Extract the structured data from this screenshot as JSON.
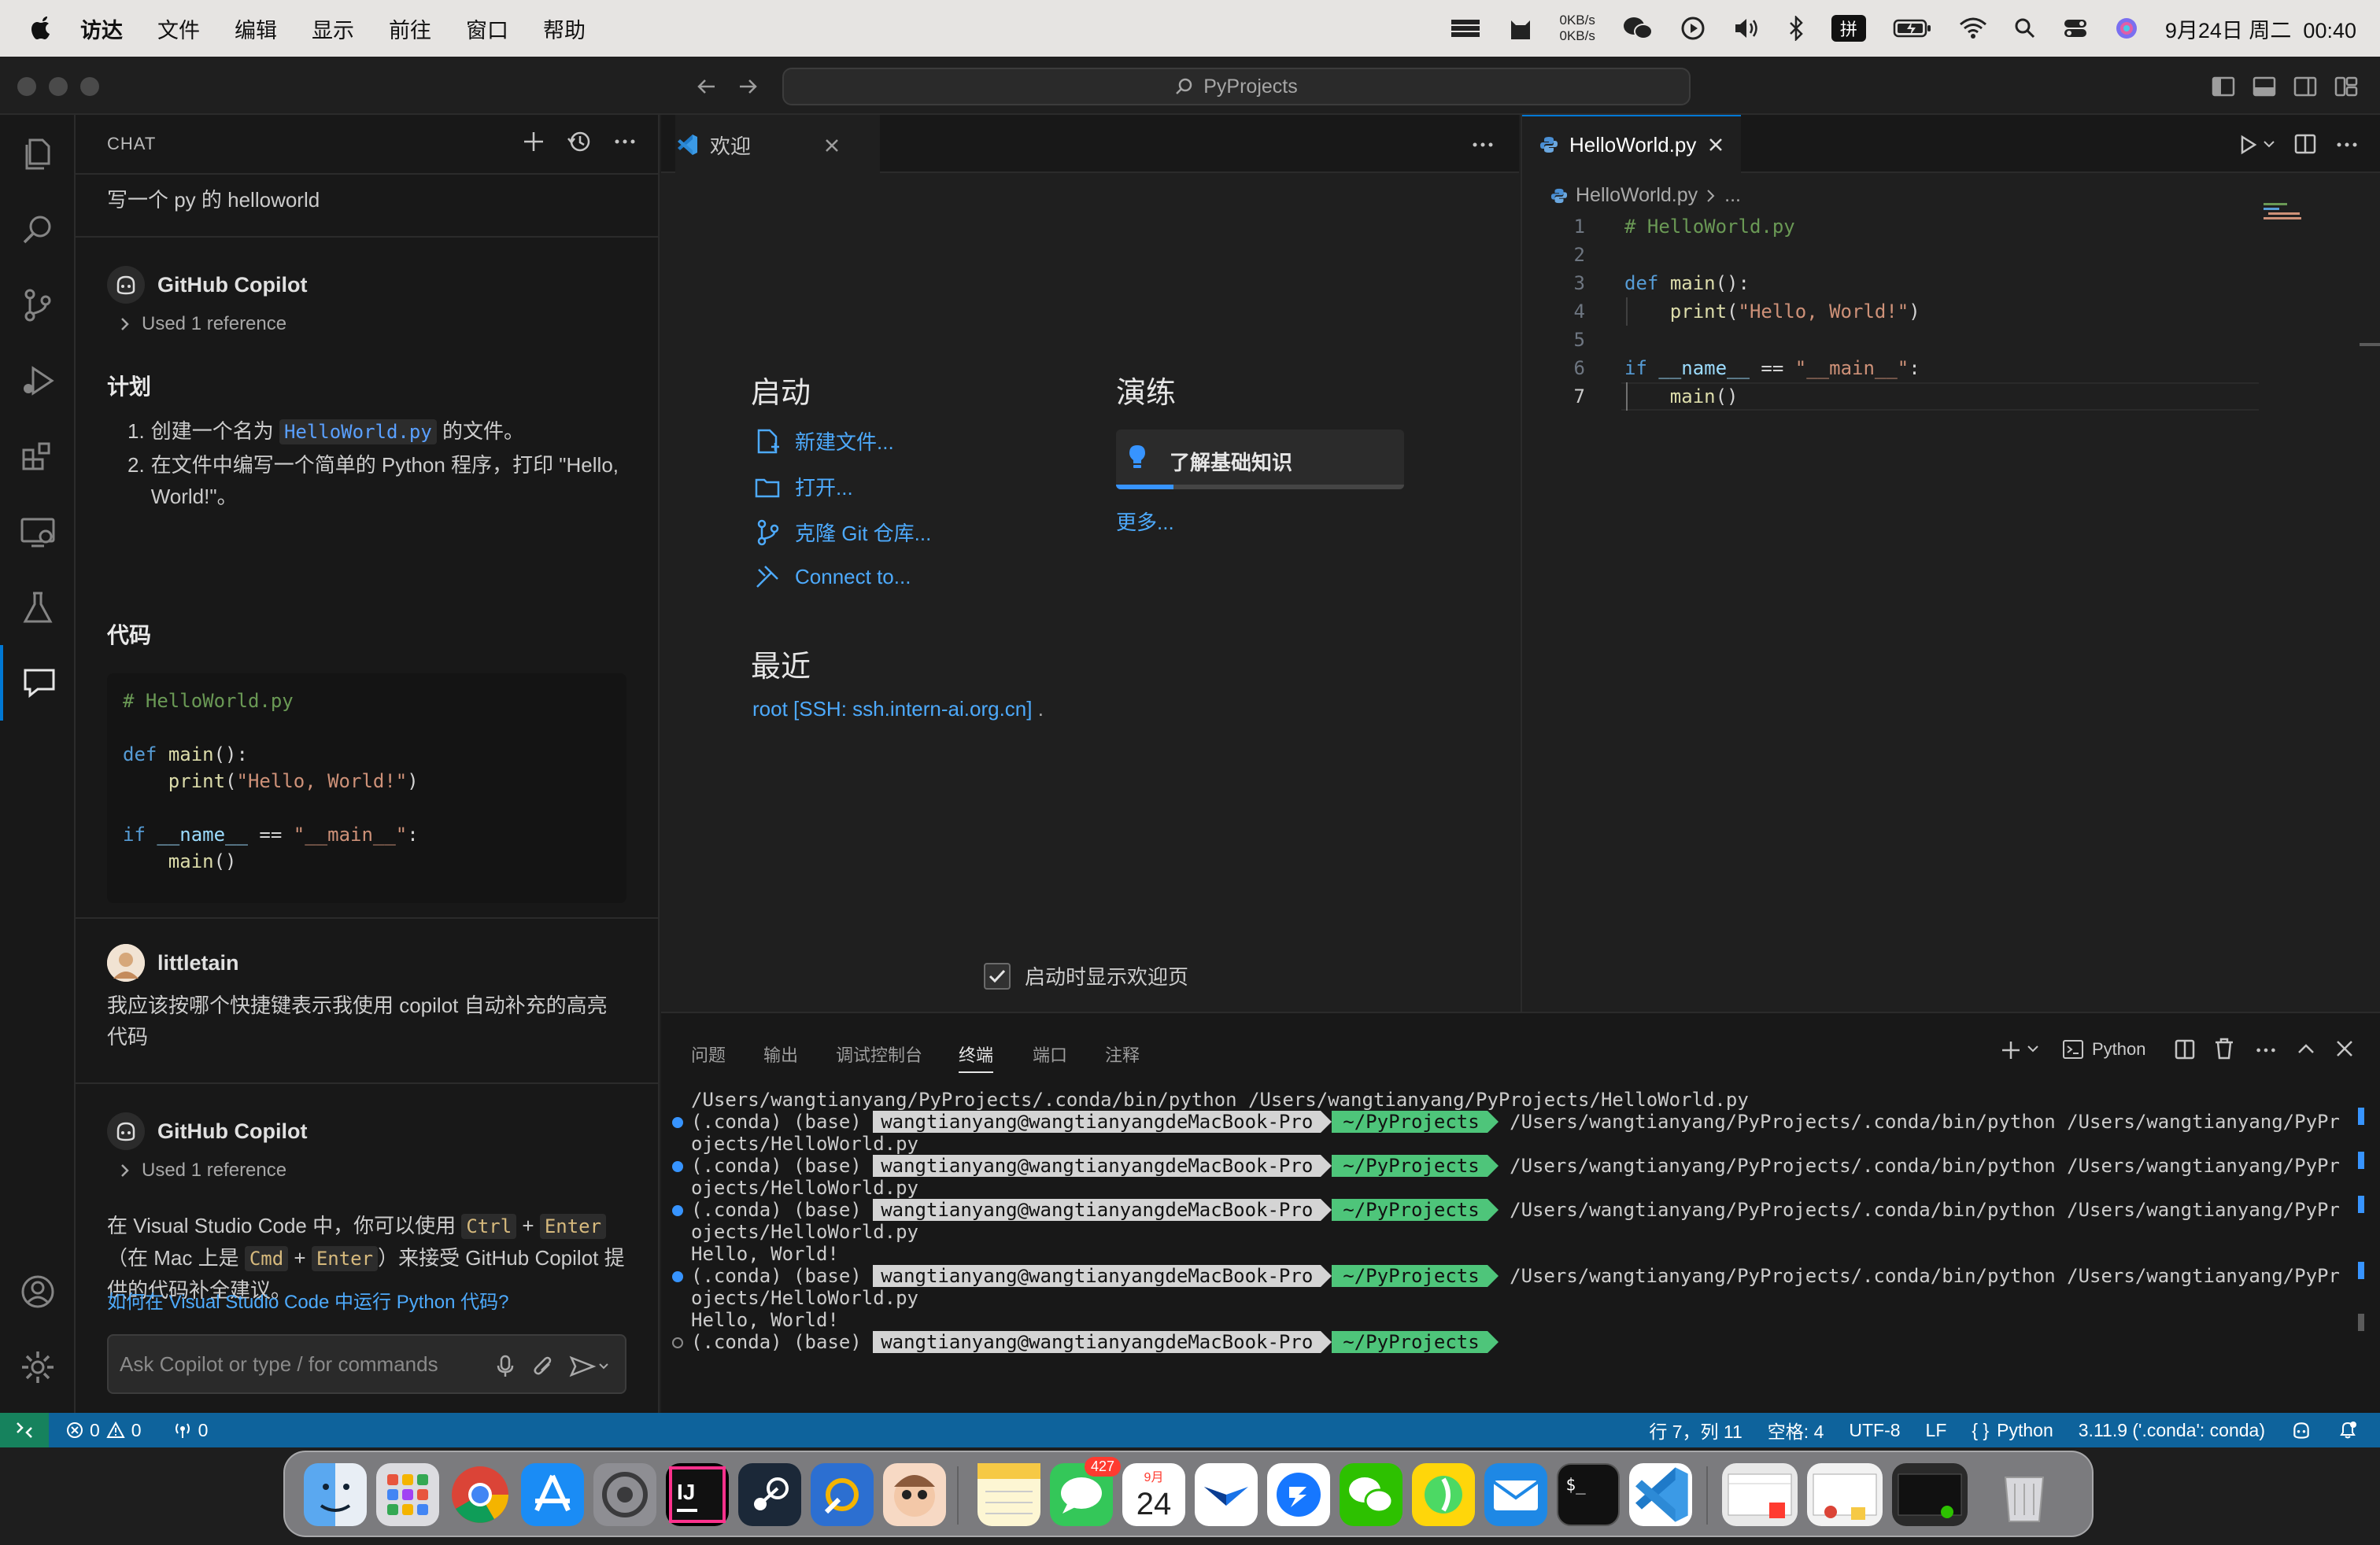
{
  "menubar": {
    "app_name": "访达",
    "menus": [
      "文件",
      "编辑",
      "显示",
      "前往",
      "窗口",
      "帮助"
    ],
    "net_up": "0KB/s",
    "net_down": "0KB/s",
    "input_method": "拼",
    "datetime": "9月24日 周二  00:40"
  },
  "titlebar": {
    "search_text": "PyProjects"
  },
  "chat": {
    "header": "CHAT",
    "user_question_1": "写一个 py 的 helloworld",
    "copilot_name": "GitHub Copilot",
    "used_reference": "Used 1 reference",
    "plan_heading": "计划",
    "plan_item_1_prefix": "创建一个名为",
    "plan_item_1_code": "HelloWorld.py",
    "plan_item_1_suffix": "的文件。",
    "plan_item_2": "在文件中编写一个简单的 Python 程序，打印 \"Hello, World!\"。",
    "code_heading": "代码",
    "code_comment": "# HelloWorld.py",
    "user_name": "littletain",
    "user_question_2": "我应该按哪个快捷键表示我使用 copilot 自动补充的高亮代码",
    "answer_p1": "在 Visual Studio Code 中，你可以使用",
    "answer_kbd_ctrl": "Ctrl",
    "answer_plus": "+",
    "answer_kbd_enter": "Enter",
    "answer_p2": "（在 Mac 上是",
    "answer_kbd_cmd": "Cmd",
    "answer_p3": "）来接受 GitHub Copilot 提供的代码补全建议。",
    "followup": "如何在 Visual Studio Code 中运行 Python 代码?",
    "input_placeholder": "Ask Copilot or type / for commands"
  },
  "welcome": {
    "tab_label": "欢迎",
    "start_heading": "启动",
    "new_file": "新建文件...",
    "open": "打开...",
    "clone_git": "克隆 Git 仓库...",
    "connect_to": "Connect to...",
    "recent_heading": "最近",
    "recent_item": "root [SSH: ssh.intern-ai.org.cn]",
    "recent_item_suffix": ".",
    "walkthrough_heading": "演练",
    "walkthrough_item": "了解基础知识",
    "walkthrough_progress": 0.2,
    "more": "更多...",
    "show_on_startup": "启动时显示欢迎页",
    "show_on_startup_checked": true
  },
  "editor": {
    "tab_label": "HelloWorld.py",
    "breadcrumb_file": "HelloWorld.py",
    "breadcrumb_more": "...",
    "line_numbers": [
      "1",
      "2",
      "3",
      "4",
      "5",
      "6",
      "7"
    ],
    "active_line": "7"
  },
  "panel": {
    "tabs": [
      "问题",
      "输出",
      "调试控制台",
      "终端",
      "端口",
      "注释"
    ],
    "active_tab": "终端",
    "terminal_profile": "Python",
    "cmd_line": "/Users/wangtianyang/PyProjects/.conda/bin/python /Users/wangtianyang/PyProjects/HelloWorld.py",
    "env": "(.conda) (base)",
    "user_host": "wangtianyang@wangtianyangdeMacBook-Pro",
    "cwd": "~/PyProjects",
    "run_cmd": "/Users/wangtianyang/PyProjects/.conda/bin/python /Users/wangtianyang/PyPr",
    "run_cmd_wrap": "ojects/HelloWorld.py",
    "output": "Hello, World!"
  },
  "statusbar": {
    "errors": "0",
    "warnings": "0",
    "ports": "0",
    "position": "行 7，列 11",
    "spaces": "空格: 4",
    "encoding": "UTF-8",
    "eol": "LF",
    "language": "Python",
    "interpreter": "3.11.9 ('.conda': conda)"
  },
  "dock": {
    "messages_badge": "427",
    "calendar_month": "9月",
    "calendar_day": "24"
  },
  "colors": {
    "accent": "#0078d4",
    "statusbar": "#0e639c",
    "link": "#4daafc",
    "terminal_dir": "#4ec57a"
  }
}
